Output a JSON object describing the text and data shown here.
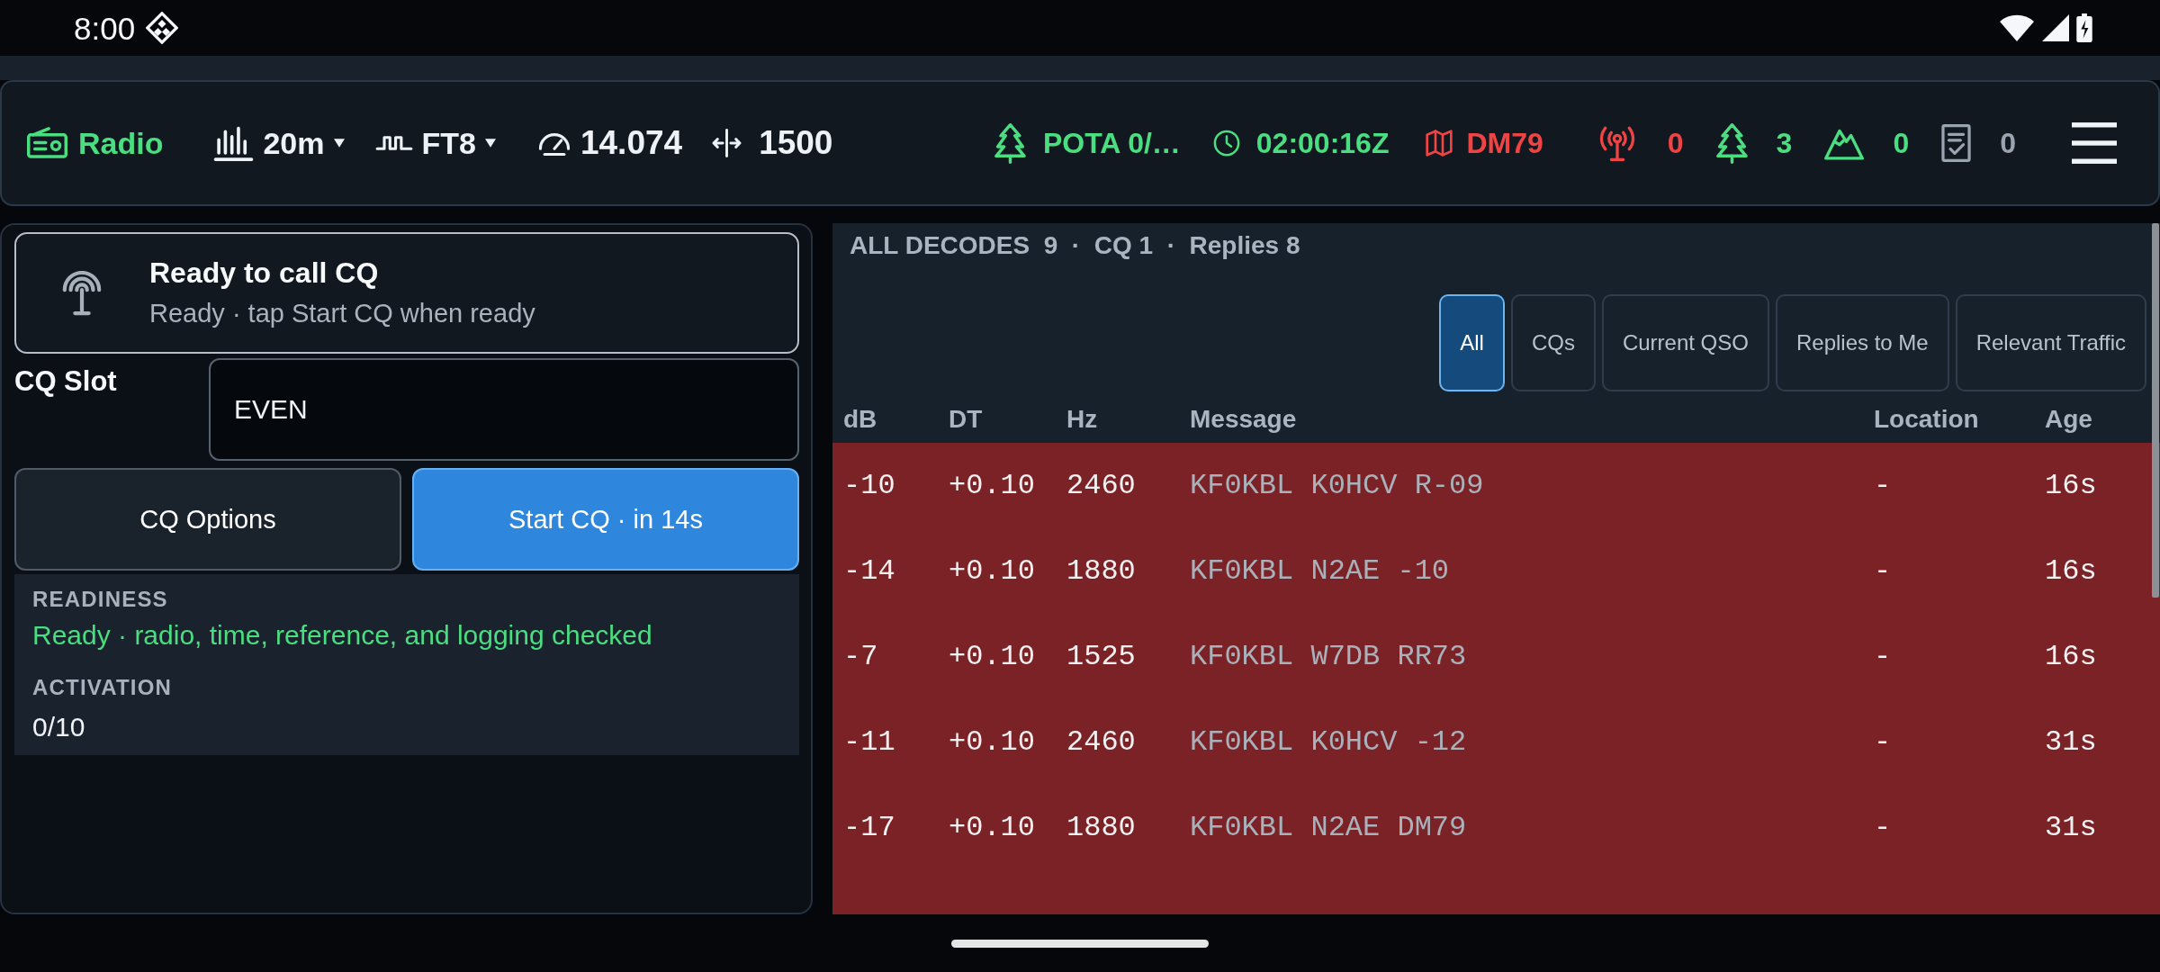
{
  "status_bar": {
    "time": "8:00"
  },
  "toolbar": {
    "controls": [
      {
        "kind": "radio",
        "label": "Radio",
        "color": "#4ade80",
        "dropdown": false
      },
      {
        "kind": "band",
        "label": "20m",
        "color": "#eef2f6",
        "dropdown": true
      },
      {
        "kind": "mode",
        "label": "FT8",
        "color": "#eef2f6",
        "dropdown": true
      },
      {
        "kind": "frequency",
        "label": "14.074",
        "color": "#eef2f6",
        "dropdown": false
      },
      {
        "kind": "offset",
        "label": "1500",
        "color": "#eef2f6",
        "dropdown": false
      }
    ],
    "indicators": [
      {
        "kind": "park",
        "label": "POTA 0/…",
        "color": "#4ade80"
      },
      {
        "kind": "clock",
        "label": "02:00:16Z",
        "color": "#4ade80"
      },
      {
        "kind": "grid",
        "label": "DM79",
        "color": "#ef4444"
      }
    ],
    "counters": [
      {
        "kind": "antenna",
        "count": "0",
        "color": "#ef4444"
      },
      {
        "kind": "park",
        "count": "3",
        "color": "#4ade80"
      },
      {
        "kind": "summit",
        "count": "0",
        "color": "#4ade80"
      },
      {
        "kind": "log",
        "count": "0",
        "color": "#9aa4b0"
      }
    ]
  },
  "cq_status": {
    "title": "Ready to call CQ",
    "subtitle": "Ready · tap Start CQ when ready"
  },
  "cq_slot": {
    "label": "CQ Slot",
    "value": "EVEN"
  },
  "actions": [
    {
      "label": "CQ Options",
      "primary": false
    },
    {
      "label": "Start CQ · in 14s",
      "primary": true
    }
  ],
  "readiness": {
    "heading": "READINESS",
    "status": "Ready · radio, time, reference, and logging checked",
    "ok": true
  },
  "activation": {
    "heading": "ACTIVATION",
    "value": "0/10"
  },
  "decodes": {
    "summary": "ALL DECODES  9  ·  CQ 1  ·  Replies 8",
    "filters": [
      {
        "label": "All",
        "selected": true
      },
      {
        "label": "CQs",
        "selected": false
      },
      {
        "label": "Current QSO",
        "selected": false
      },
      {
        "label": "Replies to Me",
        "selected": false
      },
      {
        "label": "Relevant Traffic",
        "selected": false
      }
    ],
    "table": {
      "columns": [
        "dB",
        "DT",
        "Hz",
        "Message",
        "Location",
        "Age"
      ],
      "rows": [
        {
          "cells": [
            "-10",
            "+0.10",
            "2460",
            "KF0KBL K0HCV R-09",
            "-",
            "16s"
          ],
          "highlighted": true
        },
        {
          "cells": [
            "-14",
            "+0.10",
            "1880",
            "KF0KBL N2AE -10",
            "-",
            "16s"
          ],
          "highlighted": true
        },
        {
          "cells": [
            "-7",
            "+0.10",
            "1525",
            "KF0KBL W7DB RR73",
            "-",
            "16s"
          ],
          "highlighted": true
        },
        {
          "cells": [
            "-11",
            "+0.10",
            "2460",
            "KF0KBL K0HCV -12",
            "-",
            "31s"
          ],
          "highlighted": true
        },
        {
          "cells": [
            "-17",
            "+0.10",
            "1880",
            "KF0KBL N2AE DM79",
            "-",
            "31s"
          ],
          "highlighted": true
        }
      ]
    }
  }
}
